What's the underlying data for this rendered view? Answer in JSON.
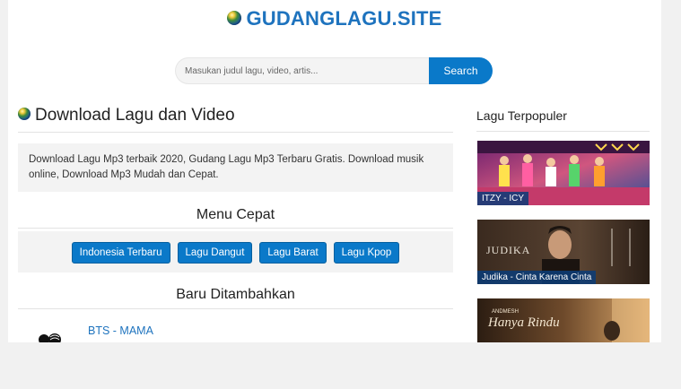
{
  "header": {
    "site_title": "GUDANGLAGU.SITE"
  },
  "search": {
    "placeholder": "Masukan judul lagu, video, artis...",
    "button_label": "Search"
  },
  "main": {
    "heading": "Download Lagu dan Video",
    "description": "Download Lagu Mp3 terbaik 2020, Gudang Lagu Mp3 Terbaru Gratis. Download musik online, Download Mp3 Mudah dan Cepat.",
    "quick_menu_title": "Menu Cepat",
    "quick_menu": [
      "Indonesia Terbaru",
      "Lagu Dangut",
      "Lagu Barat",
      "Lagu Kpop"
    ],
    "recent_title": "Baru Ditambahkan",
    "recent_items": [
      {
        "title": "BTS - MAMA"
      }
    ]
  },
  "sidebar": {
    "title": "Lagu Terpopuler",
    "items": [
      {
        "caption": "ITZY - ICY",
        "thumb_text": ""
      },
      {
        "caption": "Judika - Cinta Karena Cinta",
        "thumb_text": "JUDIKA"
      },
      {
        "caption": "",
        "thumb_text": "Hanya Rindu",
        "thumb_subtext": "ANDMESH"
      }
    ]
  },
  "colors": {
    "accent": "#1e73be",
    "button": "#0a79c9",
    "panel": "#f3f3f3"
  }
}
